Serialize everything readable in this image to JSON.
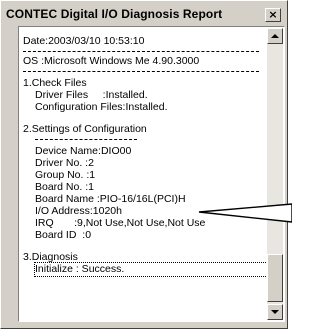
{
  "window": {
    "title": "CONTEC Digital I/O Diagnosis Report",
    "close_glyph": "×"
  },
  "report": {
    "date": "Date:2003/03/10 10:53:10",
    "os": "OS :Microsoft Windows Me 4.90.3000",
    "check_files": {
      "heading": "1.Check Files",
      "driver_files": "Driver Files     :Installed.",
      "config_files": "Configuration Files:Installed."
    },
    "settings": {
      "heading": "2.Settings of Configuration",
      "device_name": "Device Name:DIO00",
      "driver_no": "Driver No. :2",
      "group_no": "Group No. :1",
      "board_no": "Board No. :1",
      "board_name": "Board Name :PIO-16/16L(PCI)H",
      "io_address": "I/O Address:1020h",
      "irq": "IRQ       :9,Not Use,Not Use,Not Use",
      "board_id": "Board ID  :0"
    },
    "diagnosis": {
      "heading": "3.Diagnosis",
      "initialize": "Initialize : Success."
    }
  },
  "scrollbar": {
    "up_icon": "scroll-up-arrow-icon",
    "down_icon": "scroll-down-arrow-icon"
  }
}
